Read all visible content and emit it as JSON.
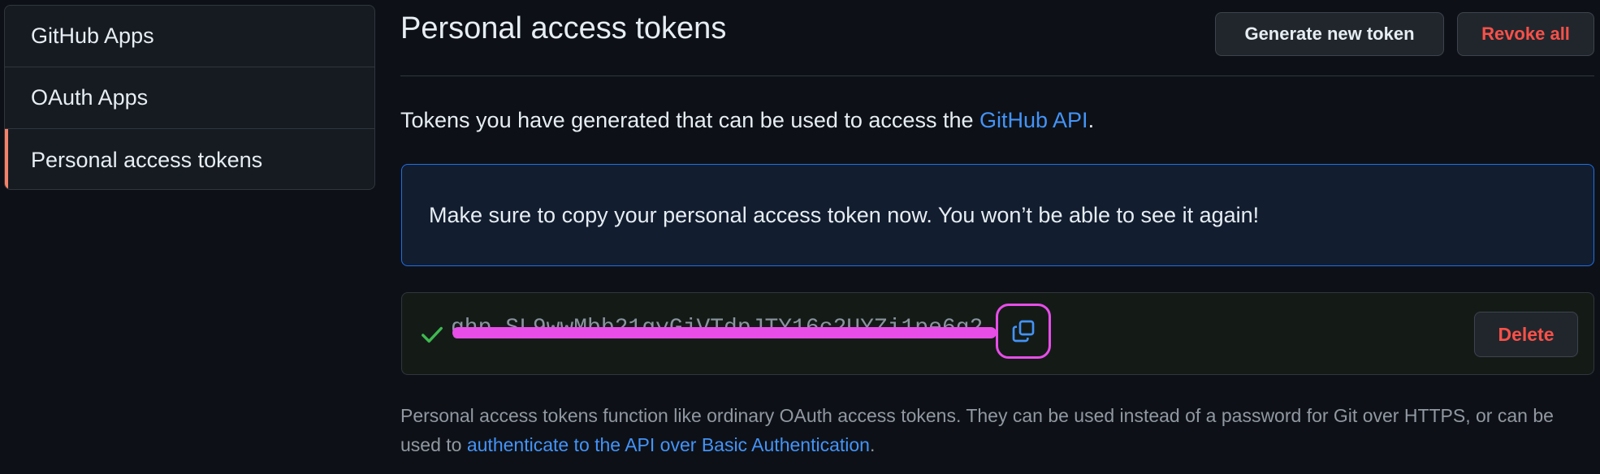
{
  "sidebar": {
    "items": [
      {
        "label": "GitHub Apps"
      },
      {
        "label": "OAuth Apps"
      },
      {
        "label": "Personal access tokens",
        "active": true
      }
    ]
  },
  "header": {
    "title": "Personal access tokens",
    "generate_label": "Generate new token",
    "revoke_label": "Revoke all"
  },
  "intro": {
    "text_before": "Tokens you have generated that can be used to access the ",
    "link": "GitHub API",
    "text_after": "."
  },
  "flash": {
    "message": "Make sure to copy your personal access token now. You won’t be able to see it again!"
  },
  "token": {
    "value": "ghp_SL9wwMbb21gyGjVTdpJTY16c2UYZi1pe6g2",
    "delete_label": "Delete"
  },
  "note": {
    "text_before": "Personal access tokens function like ordinary OAuth access tokens. They can be used instead of a password for Git over HTTPS, or can be used to ",
    "link": "authenticate to the API over Basic Authentication",
    "text_after": "."
  },
  "colors": {
    "accent_link": "#4493f8",
    "danger": "#f85149",
    "active_marker": "#f78166",
    "highlight": "#e84de8",
    "success": "#3fb950"
  },
  "icons": {
    "check": "check-icon",
    "copy": "copy-icon"
  }
}
